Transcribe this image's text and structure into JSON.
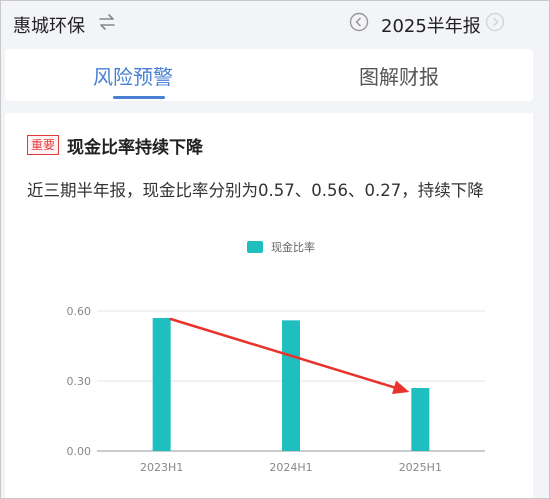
{
  "header": {
    "company": "惠城环保",
    "period": "2025半年报",
    "icons": [
      "swap-icon",
      "chevron-left-icon",
      "chevron-right-icon"
    ]
  },
  "tabs": [
    {
      "label": "风险预警",
      "active": true
    },
    {
      "label": "图解财报",
      "active": false
    }
  ],
  "alert": {
    "badge": "重要",
    "title": "现金比率持续下降",
    "description": "近三期半年报，现金比率分别为0.57、0.56、0.27，持续下降"
  },
  "colors": {
    "accent": "#4a7fd6",
    "bar": "#1fbfbf",
    "badge": "#e23b3b",
    "arrow": "#e8322b"
  },
  "chart_data": {
    "type": "bar",
    "categories": [
      "2023H1",
      "2024H1",
      "2025H1"
    ],
    "series": [
      {
        "name": "现金比率",
        "values": [
          0.57,
          0.56,
          0.27
        ]
      }
    ],
    "yticks": [
      "0.00",
      "0.30",
      "0.60"
    ],
    "ylim": [
      0,
      0.6
    ],
    "grid": true,
    "legend": "top-center",
    "annotation": "red arrow from 2023H1 bar to 2025H1 bar indicating decline"
  }
}
